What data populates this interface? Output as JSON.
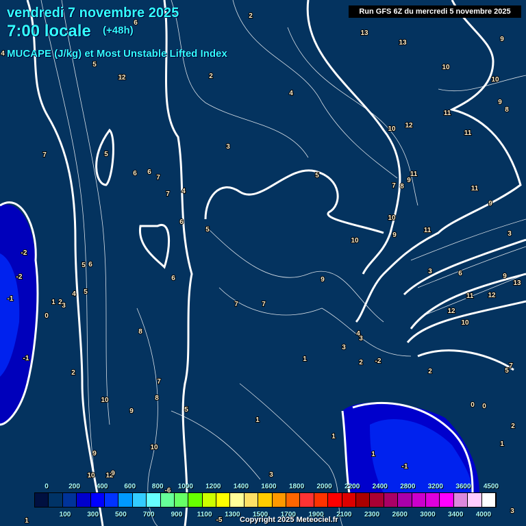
{
  "header": {
    "date": "vendredi 7 novembre 2025",
    "time": "7:00 locale",
    "lead": "(+48h)",
    "parameter": "MUCAPE (J/kg) et Most Unstable Lifted Index",
    "run": "Run GFS 6Z du mercredi 5 novembre 2025"
  },
  "legend": {
    "colors": [
      "#001040",
      "#003366",
      "#003399",
      "#0000cc",
      "#0000ff",
      "#0033ff",
      "#0099ff",
      "#33ccff",
      "#66ffff",
      "#66ff99",
      "#66ff66",
      "#66ff00",
      "#ccff00",
      "#ffff00",
      "#ffff99",
      "#ffe066",
      "#ffcc00",
      "#ff9900",
      "#ff6600",
      "#ff3333",
      "#ff3300",
      "#ff0000",
      "#dd0000",
      "#aa0000",
      "#aa0033",
      "#aa0066",
      "#aa00aa",
      "#cc00cc",
      "#dd00dd",
      "#ff00ff",
      "#dd88dd",
      "#ffccff",
      "#ffffff"
    ],
    "top_labels": [
      "0",
      "200",
      "400",
      "600",
      "800",
      "1000",
      "1200",
      "1400",
      "1600",
      "1800",
      "2000",
      "2200",
      "2400",
      "2800",
      "3200",
      "3600",
      "4500"
    ],
    "bottom_labels": [
      "100",
      "300",
      "500",
      "700",
      "900",
      "1100",
      "1300",
      "1500",
      "1700",
      "1900",
      "2100",
      "2300",
      "2600",
      "3000",
      "3400",
      "4000"
    ]
  },
  "lifted_index_labels": [
    "6",
    "7",
    "4",
    "2",
    "5",
    "5",
    "6",
    "2",
    "6",
    "4",
    "3",
    "5",
    "5",
    "6",
    "7",
    "7",
    "4",
    "6",
    "5",
    "6",
    "-2",
    "-2",
    "-1",
    "0",
    "1",
    "2",
    "3",
    "4",
    "5",
    "6",
    "8",
    "-1",
    "2",
    "7",
    "8",
    "10",
    "9",
    "9",
    "10",
    "12",
    "10",
    "5",
    "1",
    "3",
    "7",
    "7",
    "9",
    "10",
    "1",
    "3",
    "3",
    "4",
    "2",
    "-2",
    "1",
    "1",
    "0",
    "-1",
    "11",
    "13",
    "13",
    "9",
    "10",
    "10",
    "9",
    "8",
    "12",
    "10",
    "11",
    "11",
    "9",
    "7",
    "8",
    "9",
    "11",
    "10",
    "11",
    "9",
    "3",
    "6",
    "11",
    "12",
    "12",
    "10",
    "13",
    "9",
    "3",
    "7",
    "5",
    "2",
    "0",
    "1",
    "2",
    "3",
    "2",
    "1",
    "-5",
    "-6",
    "9",
    "12"
  ],
  "copyright": "Copyright 2025 Meteociel.fr"
}
